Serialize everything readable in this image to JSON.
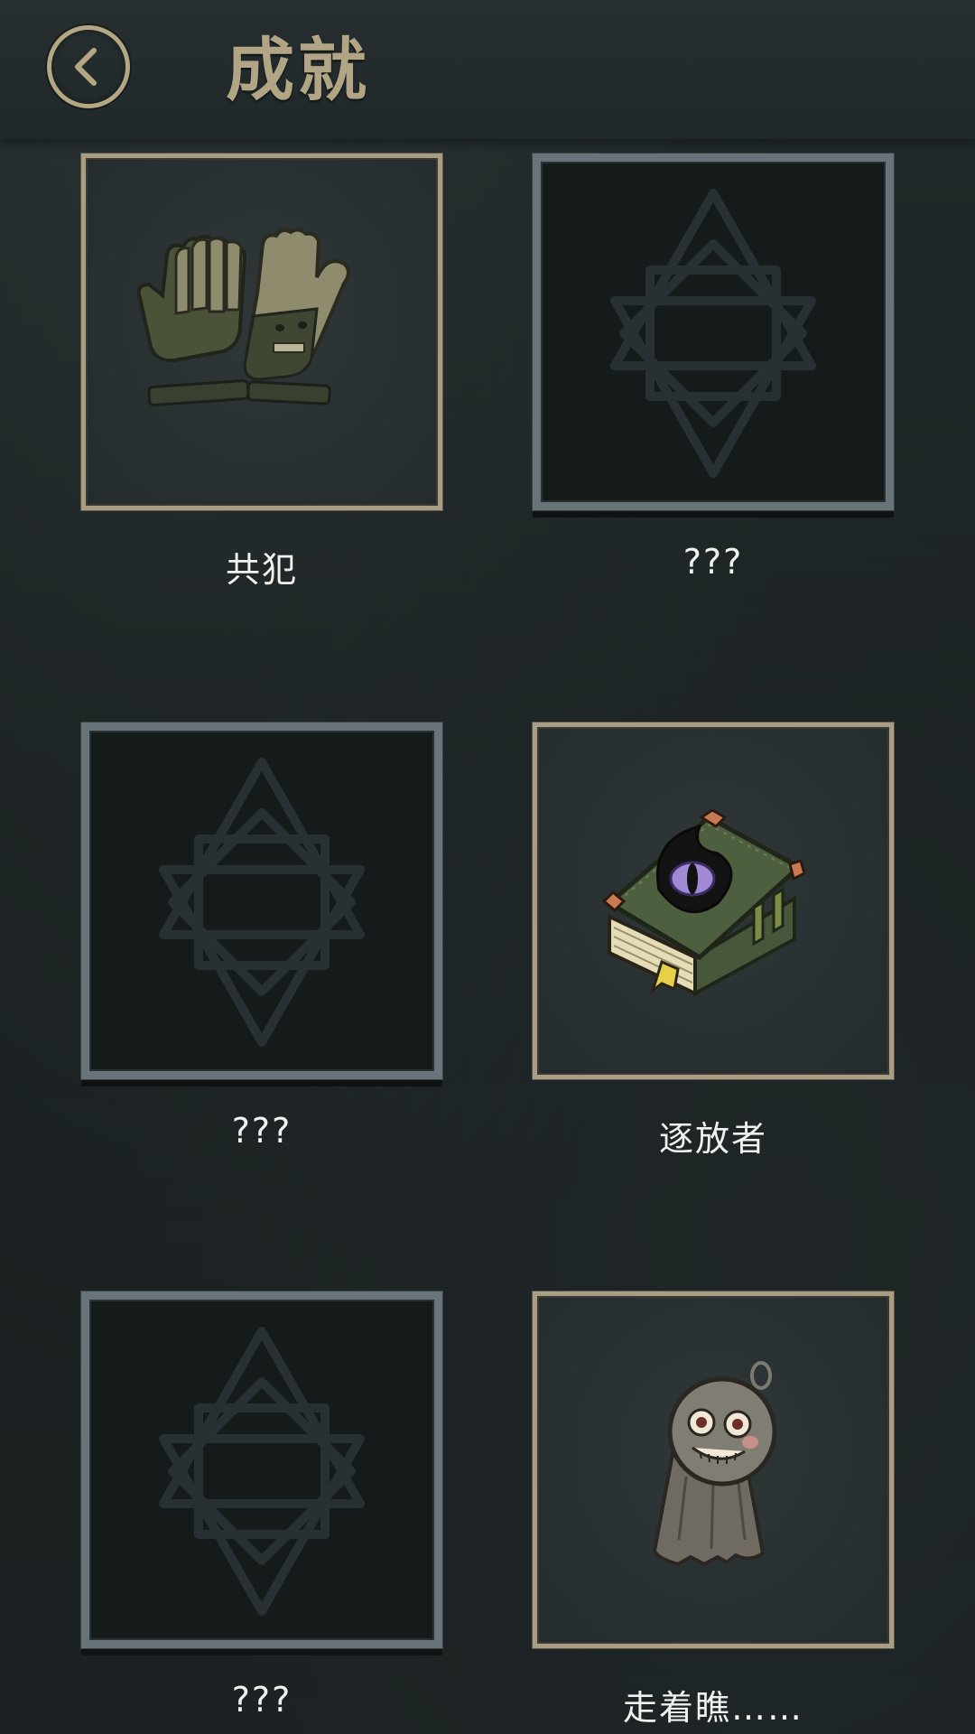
{
  "header": {
    "title": "成就",
    "back_icon": "chevron-left-icon"
  },
  "achievements": [
    {
      "label": "共犯",
      "state": "unlocked",
      "icon": "gloves-icon"
    },
    {
      "label": "???",
      "state": "locked",
      "icon": "octagram-icon"
    },
    {
      "label": "???",
      "state": "locked",
      "icon": "octagram-icon"
    },
    {
      "label": "逐放者",
      "state": "unlocked",
      "icon": "eye-book-icon"
    },
    {
      "label": "???",
      "state": "locked",
      "icon": "octagram-icon"
    },
    {
      "label": "走着瞧……",
      "state": "unlocked",
      "icon": "teru-teru-bozu-icon"
    }
  ],
  "colors": {
    "title": "#b1a585",
    "back_ring": "#b3a682",
    "unlocked_frame": "#a99e84",
    "locked_frame": "#68747a",
    "label": "#f1f1ed"
  }
}
